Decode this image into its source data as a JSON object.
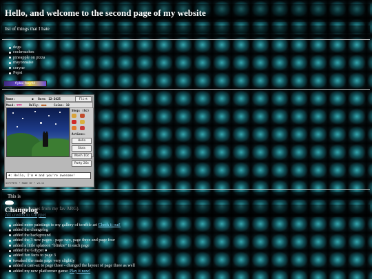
{
  "header": {
    "title": "Hello, and welcome to the second page of my website"
  },
  "hate": {
    "heading": "list of things that I hate",
    "items": [
      "dogs",
      "cockroaches",
      "pineapple on pizza",
      "mayonnaise",
      "coryne",
      "Pepsi"
    ]
  },
  "blinkie": {
    "text": "flyboi foxy94"
  },
  "gifypet": {
    "name_label": "Name:",
    "born_label": "Born:",
    "born_value": "12-2025",
    "flirt_button": "Flirt",
    "mood_label": "Mood:",
    "belly_label": "Belly:",
    "coins_label": "Coins:",
    "coins_value": "10",
    "shop_label": "Shop: (5c)",
    "actions_label": "Actions:",
    "actions": [
      "Hello",
      "Slots",
      "Wash 10c",
      "Party 20c"
    ],
    "speech": "♦: Hello, I'm ♦ and you're awesome!",
    "footer": "GIFYPETS • MADE BY • v0.11"
  },
  "caption": {
    "prefix": "This is",
    "suffix": "(the name comes from my fav ARG).",
    "link": "All credits to Gifypet"
  },
  "changelog": {
    "heading": "Changelog",
    "items": [
      {
        "text": "added more paintings to my gallery of terrible art",
        "link": "Check it out!"
      },
      {
        "text": "added the changelog",
        "link": ""
      },
      {
        "text": "added the background",
        "link": ""
      },
      {
        "text": "added the 3 new pages - page two, page three and page four",
        "link": ""
      },
      {
        "text": "added a little splatoon \"blinkie\" in each page",
        "link": ""
      },
      {
        "text": "added the Gifypet ●",
        "link": ""
      },
      {
        "text": "added fun facts to page 3",
        "link": ""
      },
      {
        "text": "tweaked the main page very slightly",
        "link": ""
      },
      {
        "text": "added a cam-ax to page three - changed the layout of page three as well",
        "link": ""
      },
      {
        "text": "added my new platformer game:",
        "link": "Play it now!"
      }
    ]
  }
}
